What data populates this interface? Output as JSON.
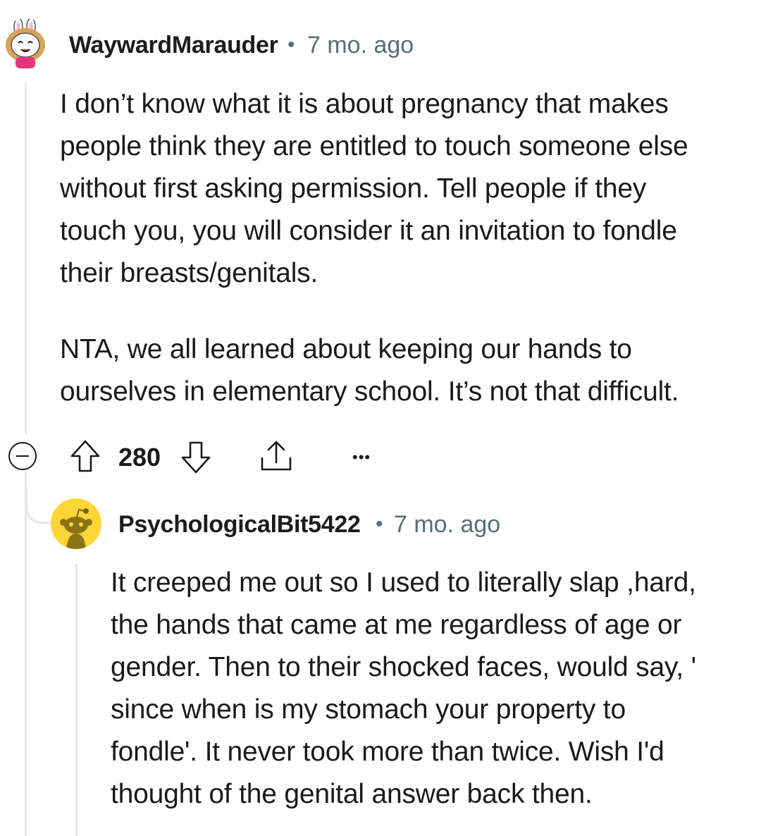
{
  "comment": {
    "author": "WaywardMarauder",
    "separator": "•",
    "time": "7 mo. ago",
    "paragraphs": [
      [
        "I don’t know what it is about pregnancy that makes",
        "people think they are entitled to touch someone else",
        "without first asking permission. Tell people if they",
        "touch you, you will consider it an invitation to fondle",
        "their breasts/genitals."
      ],
      [
        "NTA, we all learned about keeping our hands to",
        "ourselves in elementary school. It’s not that difficult."
      ]
    ],
    "score": "280",
    "more_label": "•••"
  },
  "reply": {
    "author": "PsychologicalBit5422",
    "separator": "•",
    "time": "7 mo. ago",
    "lines": [
      "It creeped me out so I used to literally slap ,hard,",
      "the hands that came at me regardless of age or",
      "gender. Then to their shocked faces, would say, '",
      "since when is my stomach your property to",
      "fondle'. It never took more than twice. Wish I'd",
      "thought of the genital answer back then."
    ]
  },
  "colors": {
    "text": "#1a1a1b",
    "meta": "#576f76",
    "thread": "#e5e7e9",
    "reply_avatar_bg": "#ffd635"
  },
  "icons": {
    "collapse": "minus-circle-icon",
    "upvote": "upvote-arrow-icon",
    "downvote": "downvote-arrow-icon",
    "share": "share-icon",
    "more": "more-options-icon"
  }
}
